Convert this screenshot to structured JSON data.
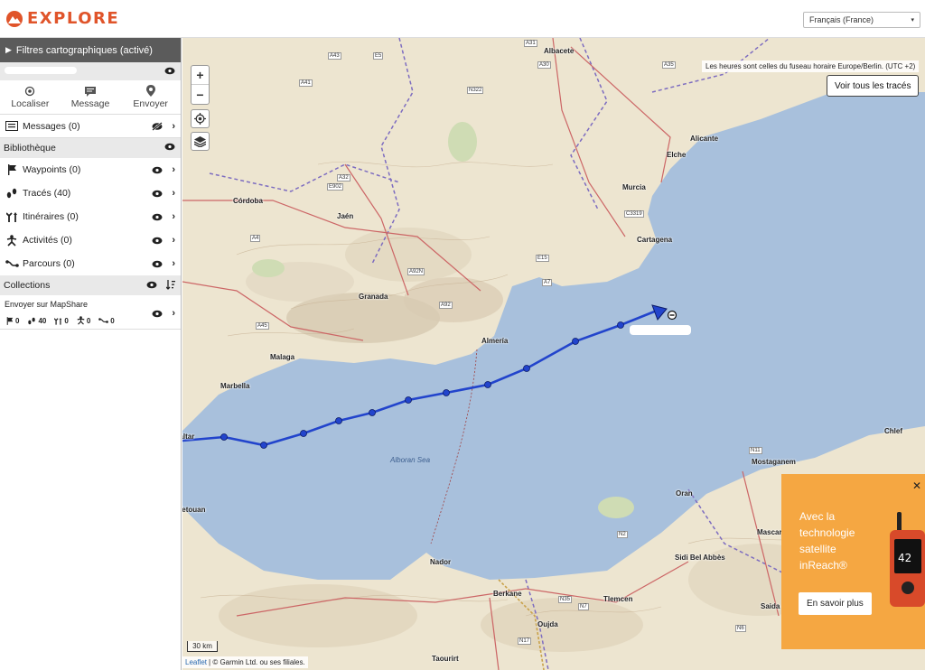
{
  "header": {
    "brand": "EXPLORE",
    "language": "Français (France)"
  },
  "sidebar": {
    "filters_label": "Filtres cartographiques (activé)",
    "actions": [
      {
        "label": "Localiser",
        "icon": "locate-icon"
      },
      {
        "label": "Message",
        "icon": "message-icon"
      },
      {
        "label": "Envoyer",
        "icon": "send-pin-icon"
      }
    ],
    "messages_label": "Messages (0)",
    "library_label": "Bibliothèque",
    "library_items": [
      {
        "label": "Waypoints (0)",
        "icon": "flag-icon"
      },
      {
        "label": "Tracés (40)",
        "icon": "footprints-icon"
      },
      {
        "label": "Itinéraires (0)",
        "icon": "route-icon"
      },
      {
        "label": "Activités (0)",
        "icon": "activity-icon"
      },
      {
        "label": "Parcours (0)",
        "icon": "course-icon"
      }
    ],
    "collections_label": "Collections",
    "mapshare": {
      "title": "Envoyer sur MapShare",
      "stats": [
        "0",
        "40",
        "0",
        "0",
        "0"
      ]
    }
  },
  "map": {
    "timezone_note": "Les heures sont celles du fuseau horaire Europe/Berlin. (UTC +2)",
    "view_all_label": "Voir tous les tracés",
    "zoom_in": "+",
    "zoom_out": "−",
    "scale_label": "30 km",
    "attribution_link": "Leaflet",
    "attribution_text": "| © Garmin Ltd. ou ses filiales.",
    "cities": [
      "Albacete",
      "Alicante",
      "Elche",
      "Murcia",
      "Cartagena",
      "Córdoba",
      "Jaén",
      "Granada",
      "Almería",
      "Malaga",
      "Marbella",
      "Gibraltar",
      "Nador",
      "Berkane",
      "Oujda",
      "Tlemcen",
      "Oran",
      "Sidi Bel Abbès",
      "Mostaganem",
      "Chlef",
      "Mascara",
      "Saida",
      "Taourirt",
      "Tetouan"
    ],
    "road_labels": [
      "A31",
      "A43",
      "E5",
      "A30",
      "A35",
      "A41",
      "N322",
      "A32",
      "E902",
      "A4",
      "C3319",
      "E15",
      "A92N",
      "A7",
      "A92",
      "A45",
      "N2",
      "N35",
      "N7",
      "N11",
      "N17",
      "N6"
    ],
    "sea_label": "Alboran Sea",
    "colors": {
      "sea": "#a8c0dc",
      "land": "#ede5d0",
      "track": "#2244cc",
      "accent": "#e0542a",
      "promo": "#f5a742"
    }
  },
  "promo": {
    "headline": "Avec la technologie satellite inReach®",
    "cta": "En savoir plus",
    "close": "✕"
  }
}
